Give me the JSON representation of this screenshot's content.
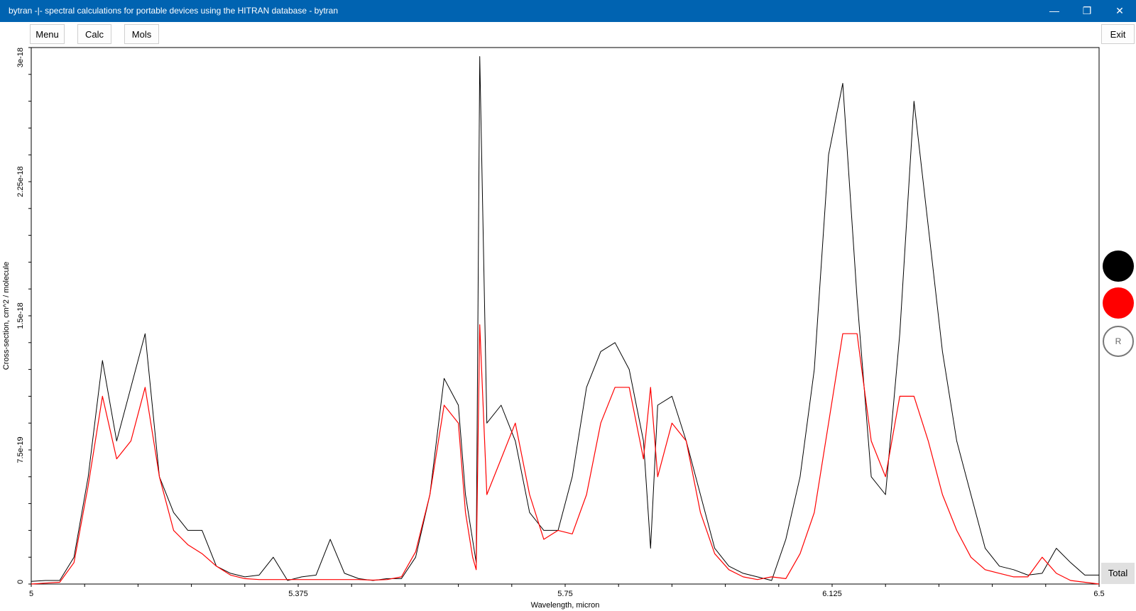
{
  "window": {
    "title": "bytran -|- spectral calculations for portable devices using the HITRAN database - bytran",
    "minimize": "—",
    "maximize": "❐",
    "close": "✕"
  },
  "toolbar": {
    "menu": "Menu",
    "calc": "Calc",
    "mols": "Mols",
    "exit": "Exit"
  },
  "side": {
    "r_label": "R",
    "total": "Total",
    "black_color": "#000000",
    "red_color": "#ff0000"
  },
  "chart_data": {
    "type": "line",
    "xlabel": "Wavelength, micron",
    "ylabel": "Cross-section, cm^2 / molecule",
    "xlim": [
      5,
      6.5
    ],
    "ylim": [
      0,
      3e-18
    ],
    "xticks": [
      5,
      5.375,
      5.75,
      6.125,
      6.5
    ],
    "xtick_labels": [
      "5",
      "5.375",
      "5.75",
      "6.125",
      "6.5"
    ],
    "yticks": [
      0,
      7.5e-19,
      1.5e-18,
      2.25e-18,
      3e-18
    ],
    "ytick_labels": [
      "0",
      "7.5e-19",
      "1.5e-18",
      "2.25e-18",
      "3e-18"
    ],
    "series": [
      {
        "color": "#000000",
        "x": [
          5.0,
          5.02,
          5.04,
          5.06,
          5.08,
          5.1,
          5.12,
          5.14,
          5.16,
          5.18,
          5.2,
          5.22,
          5.24,
          5.26,
          5.28,
          5.3,
          5.32,
          5.34,
          5.36,
          5.38,
          5.4,
          5.42,
          5.44,
          5.46,
          5.48,
          5.5,
          5.52,
          5.54,
          5.56,
          5.58,
          5.6,
          5.61,
          5.625,
          5.63,
          5.64,
          5.66,
          5.68,
          5.7,
          5.72,
          5.74,
          5.76,
          5.78,
          5.8,
          5.82,
          5.84,
          5.86,
          5.87,
          5.88,
          5.9,
          5.92,
          5.94,
          5.96,
          5.98,
          6.0,
          6.02,
          6.04,
          6.06,
          6.08,
          6.1,
          6.12,
          6.14,
          6.16,
          6.18,
          6.2,
          6.22,
          6.24,
          6.26,
          6.28,
          6.3,
          6.32,
          6.34,
          6.36,
          6.38,
          6.4,
          6.42,
          6.44,
          6.46,
          6.48,
          6.5
        ],
        "y": [
          1.5e-20,
          2e-20,
          2e-20,
          1.5e-19,
          6e-19,
          1.25e-18,
          8e-19,
          1.1e-18,
          1.4e-18,
          6e-19,
          4e-19,
          3e-19,
          3e-19,
          1e-19,
          6e-20,
          4e-20,
          5e-20,
          1.5e-19,
          2e-20,
          4e-20,
          5e-20,
          2.5e-19,
          6e-20,
          3e-20,
          2e-20,
          3e-20,
          3e-20,
          1.5e-19,
          5e-19,
          1.15e-18,
          1e-18,
          5e-19,
          1.2e-19,
          2.95e-18,
          9e-19,
          1e-18,
          8e-19,
          4e-19,
          3e-19,
          3e-19,
          6e-19,
          1.1e-18,
          1.3e-18,
          1.35e-18,
          1.2e-18,
          8e-19,
          2e-19,
          1e-18,
          1.05e-18,
          8e-19,
          5e-19,
          2e-19,
          1e-19,
          6e-20,
          4e-20,
          2e-20,
          2.5e-19,
          6e-19,
          1.2e-18,
          2.4e-18,
          2.8e-18,
          1.6e-18,
          6e-19,
          5e-19,
          1.4e-18,
          2.7e-18,
          2e-18,
          1.3e-18,
          8e-19,
          5e-19,
          2e-19,
          1e-19,
          8e-20,
          5e-20,
          6e-20,
          2e-19,
          1.2e-19,
          5e-20,
          5e-20
        ]
      },
      {
        "color": "#ff0000",
        "x": [
          5.0,
          5.02,
          5.04,
          5.06,
          5.08,
          5.1,
          5.12,
          5.14,
          5.16,
          5.18,
          5.2,
          5.22,
          5.24,
          5.26,
          5.28,
          5.3,
          5.32,
          5.34,
          5.36,
          5.38,
          5.4,
          5.42,
          5.44,
          5.46,
          5.48,
          5.5,
          5.52,
          5.54,
          5.56,
          5.58,
          5.6,
          5.61,
          5.62,
          5.625,
          5.63,
          5.64,
          5.66,
          5.68,
          5.7,
          5.72,
          5.74,
          5.76,
          5.78,
          5.8,
          5.82,
          5.84,
          5.86,
          5.87,
          5.88,
          5.9,
          5.92,
          5.94,
          5.96,
          5.98,
          6.0,
          6.02,
          6.04,
          6.06,
          6.08,
          6.1,
          6.12,
          6.14,
          6.16,
          6.18,
          6.2,
          6.22,
          6.24,
          6.26,
          6.28,
          6.3,
          6.32,
          6.34,
          6.36,
          6.38,
          6.4,
          6.42,
          6.44,
          6.46,
          6.48,
          6.5
        ],
        "y": [
          0,
          5e-21,
          1e-20,
          1.2e-19,
          5.5e-19,
          1.05e-18,
          7e-19,
          8e-19,
          1.1e-18,
          6e-19,
          3e-19,
          2.2e-19,
          1.7e-19,
          1e-19,
          5e-20,
          3e-20,
          2.5e-20,
          2.5e-20,
          2.5e-20,
          2.5e-20,
          2.5e-20,
          2.5e-20,
          2.5e-20,
          2.5e-20,
          2.2e-20,
          2.5e-20,
          4e-20,
          1.8e-19,
          5e-19,
          1e-18,
          9e-19,
          4e-19,
          1.5e-19,
          8e-20,
          1.45e-18,
          5e-19,
          7e-19,
          9e-19,
          5e-19,
          2.5e-19,
          3e-19,
          2.8e-19,
          5e-19,
          9e-19,
          1.1e-18,
          1.1e-18,
          7e-19,
          1.1e-18,
          6e-19,
          9e-19,
          8e-19,
          4e-19,
          1.7e-19,
          8e-20,
          4e-20,
          2.5e-20,
          4e-20,
          3e-20,
          1.7e-19,
          4e-19,
          9e-19,
          1.4e-18,
          1.4e-18,
          8e-19,
          6e-19,
          1.05e-18,
          1.05e-18,
          8e-19,
          5e-19,
          3e-19,
          1.5e-19,
          8e-20,
          6e-20,
          4e-20,
          4e-20,
          1.5e-19,
          6e-20,
          2e-20,
          1e-20,
          0
        ]
      }
    ]
  }
}
